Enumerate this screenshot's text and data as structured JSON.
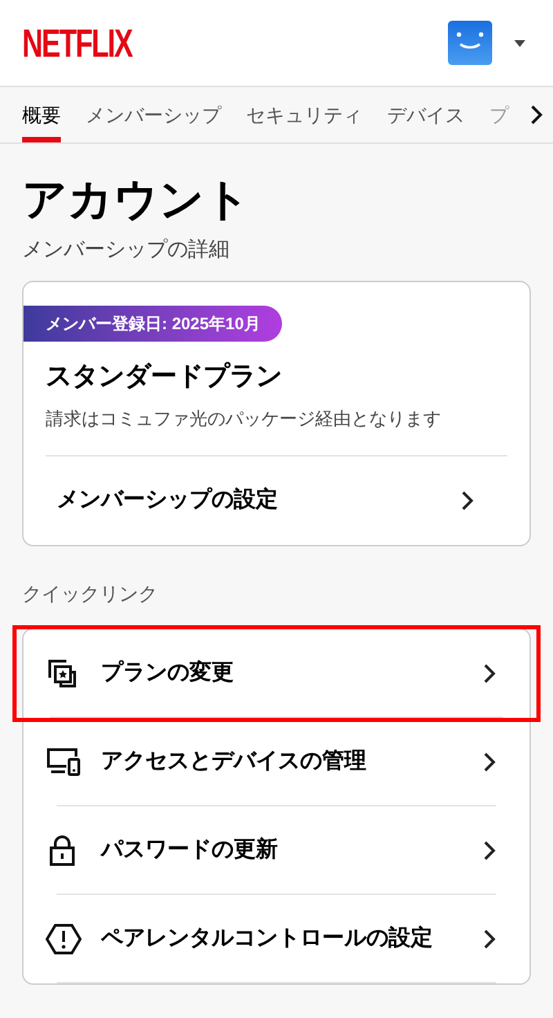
{
  "header": {
    "logo": "NETFLIX"
  },
  "tabs": [
    {
      "label": "概要",
      "selected": true
    },
    {
      "label": "メンバーシップ",
      "selected": false
    },
    {
      "label": "セキュリティ",
      "selected": false
    },
    {
      "label": "デバイス",
      "selected": false
    },
    {
      "label": "プ",
      "selected": false,
      "faded": true
    }
  ],
  "page": {
    "title": "アカウント",
    "subtitle": "メンバーシップの詳細"
  },
  "membership_card": {
    "badge": "メンバー登録日: 2025年10月",
    "plan": "スタンダードプラン",
    "billing_note": "請求はコミュファ光のパッケージ経由となります",
    "link": "メンバーシップの設定"
  },
  "quick_links": {
    "heading": "クイックリンク",
    "items": [
      {
        "kind": "plan",
        "label": "プランの変更",
        "highlighted": true
      },
      {
        "kind": "devices",
        "label": "アクセスとデバイスの管理",
        "highlighted": false
      },
      {
        "kind": "password",
        "label": "パスワードの更新",
        "highlighted": false
      },
      {
        "kind": "parental",
        "label": "ペアレンタルコントロールの設定",
        "highlighted": false
      }
    ]
  }
}
